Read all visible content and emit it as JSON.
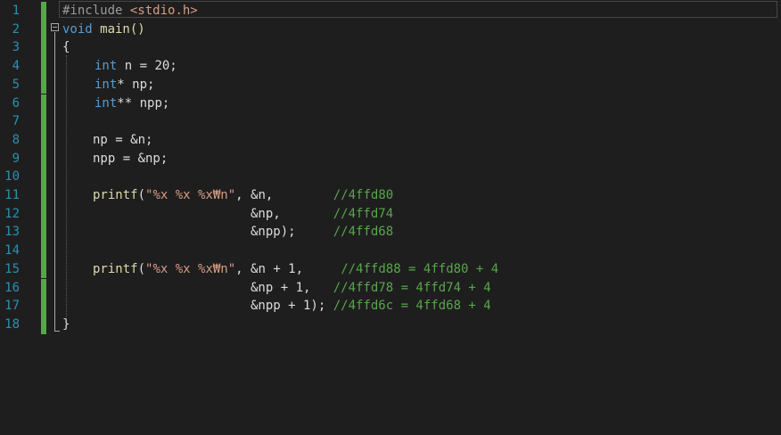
{
  "gutter": {
    "line_numbers": [
      "1",
      "2",
      "3",
      "4",
      "5",
      "6",
      "7",
      "8",
      "9",
      "10",
      "11",
      "12",
      "13",
      "14",
      "15",
      "16",
      "17",
      "18"
    ]
  },
  "code": {
    "l1": {
      "pp": "#include",
      "sp": " ",
      "header": "<stdio.h>"
    },
    "l2": {
      "kw": "void",
      "rest": " main()"
    },
    "l3": {
      "text": "{"
    },
    "l4": {
      "kw": "int",
      "rest": " n = 20;"
    },
    "l5": {
      "kw": "int",
      "rest": "* np;"
    },
    "l6": {
      "kw": "int",
      "rest": "** npp;"
    },
    "l8": {
      "text": "np = &n;"
    },
    "l9": {
      "text": "npp = &np;"
    },
    "l11": {
      "fn": "printf",
      "open": "(",
      "str": "\"%x %x %x₩n\"",
      "rest": ", &n,        ",
      "cm": "//4ffd80"
    },
    "l12": {
      "rest": "&np,       ",
      "cm": "//4ffd74"
    },
    "l13": {
      "rest": "&npp);     ",
      "cm": "//4ffd68"
    },
    "l15": {
      "fn": "printf",
      "open": "(",
      "str": "\"%x %x %x₩n\"",
      "rest": ", &n + 1,     ",
      "cm": "//4ffd88 = 4ffd80 + 4"
    },
    "l16": {
      "rest": "&np + 1,   ",
      "cm": "//4ffd78 = 4ffd74 + 4"
    },
    "l17": {
      "rest": "&npp + 1); ",
      "cm": "//4ffd6c = 4ffd68 + 4"
    },
    "l18": {
      "text": "}"
    }
  },
  "colors": {
    "background": "#1e1e1e",
    "line_number": "#2b91af",
    "keyword": "#569cd6",
    "string": "#d69d85",
    "comment": "#57a64a",
    "change_bar": "#57a64a"
  }
}
